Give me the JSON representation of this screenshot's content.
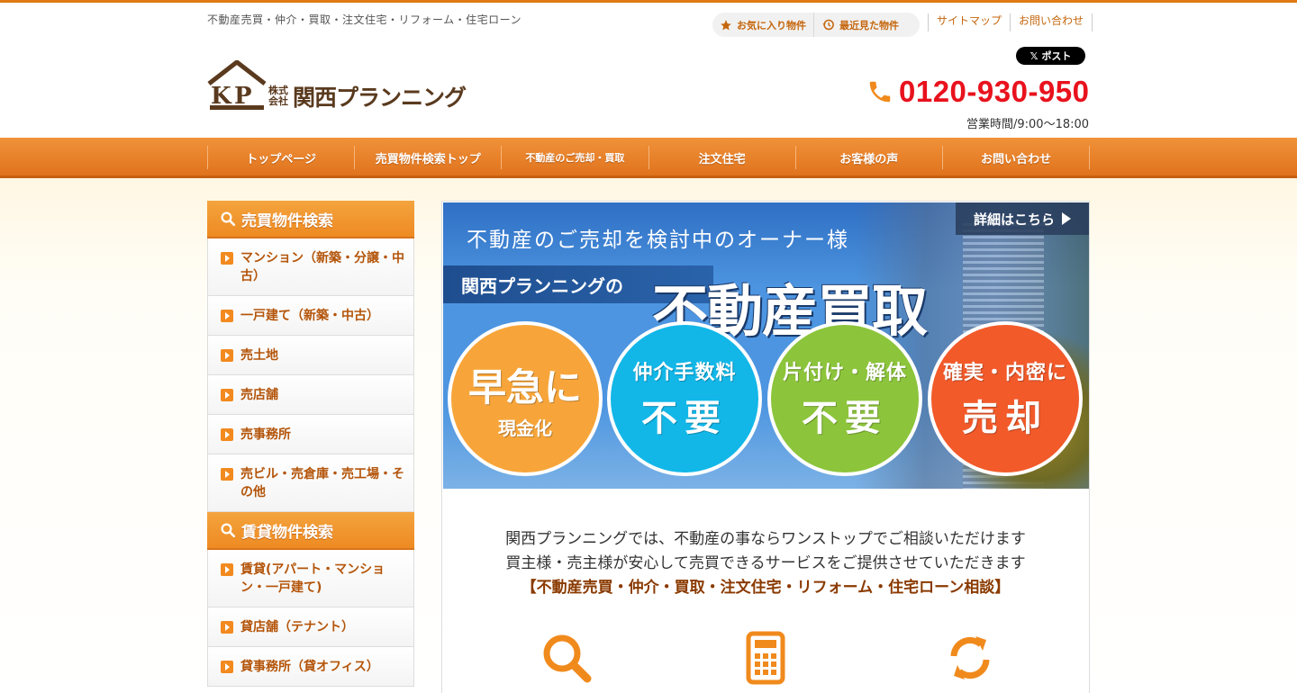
{
  "header": {
    "tagline": "不動産売買・仲介・買取・注文住宅・リフォーム・住宅ローン",
    "favorites_label": "お気に入り物件",
    "recent_label": "最近見た物件",
    "links": [
      "サイトマップ",
      "お問い合わせ"
    ],
    "x_post_label": "ポスト",
    "logo_small": "株式会社",
    "logo_name": "関西プランニング",
    "phone": "0120-930-950",
    "hours": "営業時間/9:00〜18:00"
  },
  "nav": {
    "items": [
      "トップページ",
      "売買物件検索トップ",
      "不動産のご売却・買取",
      "注文住宅",
      "お客様の声",
      "お問い合わせ"
    ]
  },
  "sidebar": {
    "sections": [
      {
        "title": "売買物件検索",
        "items": [
          "マンション（新築・分譲・中古）",
          "一戸建て（新築・中古）",
          "売土地",
          "売店舗",
          "売事務所",
          "売ビル・売倉庫・売工場・その他"
        ]
      },
      {
        "title": "賃貸物件検索",
        "items": [
          "賃貸(アパート・マンション・一戸建て)",
          "貸店舗（テナント）",
          "貸事務所（貸オフィス）"
        ]
      }
    ]
  },
  "banner": {
    "top_text": "不動産のご売却を検討中のオーナー様",
    "detail_label": "詳細はこちら",
    "strip_text": "関西プランニングの",
    "big_title": "不動産買取",
    "circles": [
      {
        "main": "早急に",
        "sub": "現金化"
      },
      {
        "main": "仲介手数料",
        "sub": "不要"
      },
      {
        "main": "片付け・解体",
        "sub": "不要"
      },
      {
        "main": "確実・内密に",
        "sub": "売却"
      }
    ]
  },
  "intro": {
    "line1": "関西プランニングでは、不動産の事ならワンストップでご相談いただけます",
    "line2": "買主様・売主様が安心して売買できるサービスをご提供させていただきます",
    "line3": "【不動産売買・仲介・買取・注文住宅・リフォーム・住宅ローン相談】"
  },
  "colors": {
    "accent": "#e07a12",
    "phone": "#e8121d",
    "link": "#c5660d"
  }
}
